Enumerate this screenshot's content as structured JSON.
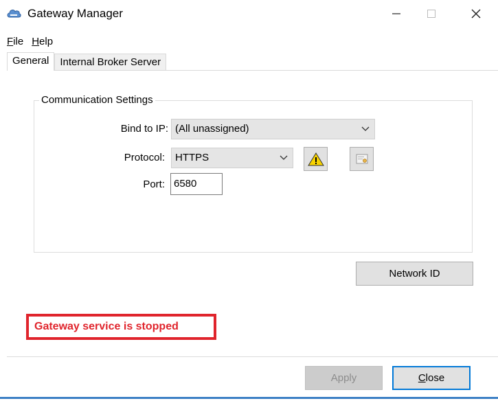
{
  "window": {
    "title": "Gateway Manager",
    "icon": "cloud-gateway-icon"
  },
  "menu": {
    "file_prefix": "F",
    "file_rest": "ile",
    "help_prefix": "H",
    "help_rest": "elp"
  },
  "tabs": [
    {
      "label": "General",
      "active": true
    },
    {
      "label": "Internal Broker Server",
      "active": false
    }
  ],
  "communication": {
    "group_title": "Communication Settings",
    "bind_label": "Bind to IP:",
    "bind_value": "(All unassigned)",
    "protocol_label": "Protocol:",
    "protocol_value": "HTTPS",
    "port_label": "Port:",
    "port_value": "6580",
    "warning_icon": "warning-icon",
    "certificate_icon": "certificate-icon"
  },
  "buttons": {
    "network_id": "Network ID",
    "apply": "Apply",
    "close_prefix": "C",
    "close_rest": "lose"
  },
  "status": {
    "text": "Gateway service is stopped",
    "color": "#e0242c"
  },
  "colors": {
    "accent": "#0078d7"
  }
}
